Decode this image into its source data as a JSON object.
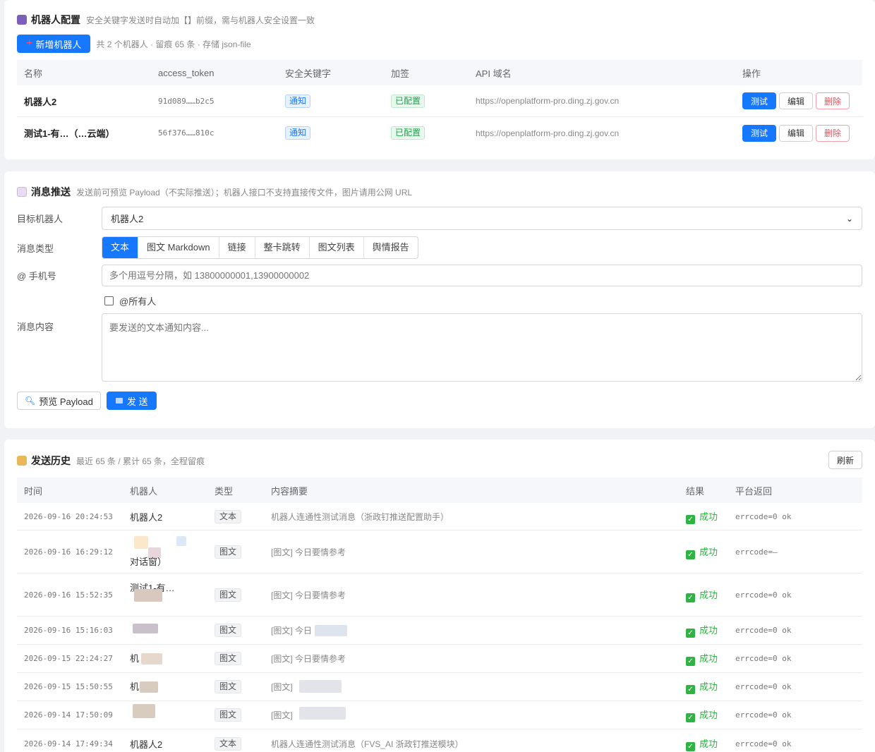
{
  "bots": {
    "title": "机器人配置",
    "subtitle": "安全关键字发送时自动加【】前缀，需与机器人安全设置一致",
    "add_button": "新增机器人",
    "summary": "共 2 个机器人 · 留痕 65 条 · 存储 json-file",
    "columns": [
      "名称",
      "access_token",
      "安全关键字",
      "加签",
      "API 域名",
      "操作"
    ],
    "rows": [
      {
        "name": "机器人2",
        "token": "91d089……b2c5",
        "keyword": "通知",
        "sign": "已配置",
        "api": "https://openplatform-pro.ding.zj.gov.cn"
      },
      {
        "name": "测试1-有…（…云端）",
        "token": "56f376……810c",
        "keyword": "通知",
        "sign": "已配置",
        "api": "https://openplatform-pro.ding.zj.gov.cn"
      }
    ],
    "actions": {
      "test": "测试",
      "edit": "编辑",
      "delete": "删除"
    }
  },
  "push": {
    "title": "消息推送",
    "subtitle": "发送前可预览 Payload（不实际推送）；机器人接口不支持直接传文件，图片请用公网 URL",
    "target_label": "目标机器人",
    "target_value": "机器人2",
    "type_label": "消息类型",
    "types": [
      "文本",
      "图文 Markdown",
      "链接",
      "整卡跳转",
      "图文列表",
      "舆情报告"
    ],
    "phone_label": "@ 手机号",
    "phone_placeholder": "多个用逗号分隔，如 13800000001,13900000002",
    "at_all": "@所有人",
    "content_label": "消息内容",
    "content_placeholder": "要发送的文本通知内容...",
    "preview_button": "预览 Payload",
    "send_button": "发 送"
  },
  "history": {
    "title": "发送历史",
    "subtitle": "最近 65 条 / 累计 65 条，全程留痕",
    "refresh": "刷新",
    "columns": [
      "时间",
      "机器人",
      "类型",
      "内容摘要",
      "结果",
      "平台返回"
    ],
    "rows": [
      {
        "time": "2026-09-16 20:24:53",
        "bot": "机器人2",
        "type": "文本",
        "summary": "机器人连通性测试消息（浙政钉推送配置助手）",
        "result": "成功",
        "ret": "errcode=0 ok"
      },
      {
        "time": "2026-09-16 16:29:12",
        "bot": "对话窗）",
        "type": "图文",
        "summary": "[图文] 今日要情参考",
        "result": "成功",
        "ret": "errcode=—"
      },
      {
        "time": "2026-09-16 15:52:35",
        "bot": "测试1-有…",
        "type": "图文",
        "summary": "[图文] 今日要情参考",
        "result": "成功",
        "ret": "errcode=0 ok"
      },
      {
        "time": "2026-09-16 15:16:03",
        "bot": "",
        "type": "图文",
        "summary": "[图文] 今日",
        "result": "成功",
        "ret": "errcode=0 ok"
      },
      {
        "time": "2026-09-15 22:24:27",
        "bot": "机",
        "type": "图文",
        "summary": "[图文] 今日要情参考",
        "result": "成功",
        "ret": "errcode=0 ok"
      },
      {
        "time": "2026-09-15 15:50:55",
        "bot": "机",
        "type": "图文",
        "summary": "[图文]",
        "result": "成功",
        "ret": "errcode=0 ok"
      },
      {
        "time": "2026-09-14 17:50:09",
        "bot": "",
        "type": "图文",
        "summary": "[图文]",
        "result": "成功",
        "ret": "errcode=0 ok"
      },
      {
        "time": "2026-09-14 17:49:34",
        "bot": "机器人2",
        "type": "文本",
        "summary": "机器人连通性测试消息（FVS_AI 浙政钉推送模块）",
        "result": "成功",
        "ret": "errcode=0 ok"
      }
    ]
  }
}
